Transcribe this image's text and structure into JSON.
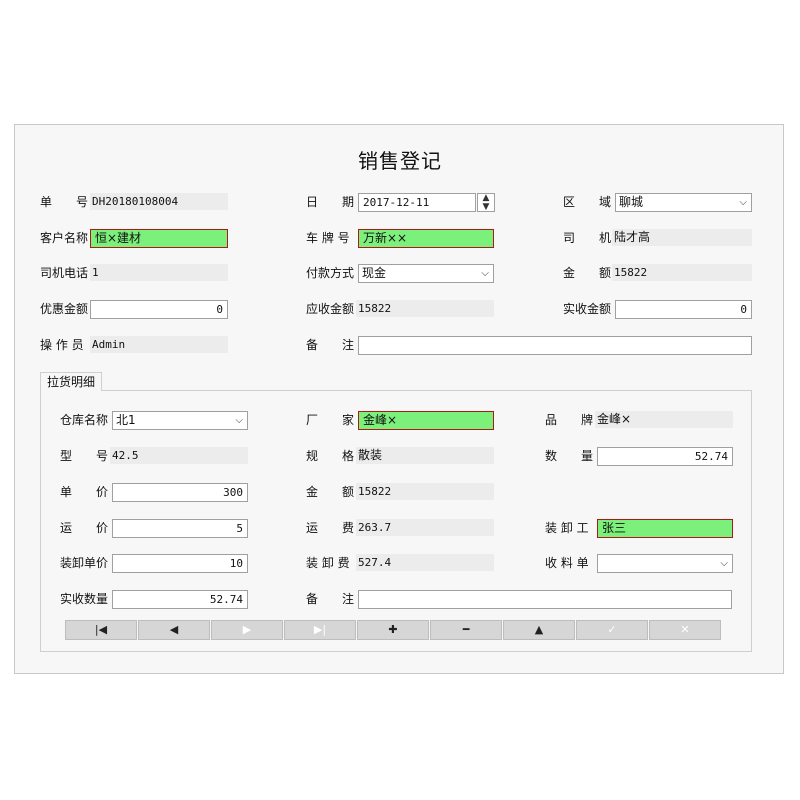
{
  "window": {
    "title": "销售登记"
  },
  "header": {
    "order_no_label": "单　　号",
    "order_no": "DH20180108004",
    "date_label": "日　　期",
    "date": "2017-12-11",
    "date_spin_icon": "spin-arrows",
    "region_label": "区　　域",
    "region": "聊城",
    "customer_label": "客户名称",
    "customer": "恒×建材",
    "plate_label": "车 牌 号",
    "plate": "万新××",
    "driver_label": "司　　机",
    "driver": "陆才高",
    "driver_phone_label": "司机电话",
    "driver_phone": "1",
    "pay_method_label": "付款方式",
    "pay_method": "现金",
    "amount_label": "金　　额",
    "amount": "15822",
    "discount_label": "优惠金额",
    "discount": "0",
    "receivable_label": "应收金额",
    "receivable": "15822",
    "received_label": "实收金额",
    "received": "0",
    "operator_label": "操 作 员",
    "operator": "Admin",
    "remark_label": "备　　注",
    "remark": ""
  },
  "detail": {
    "tab_label": "拉货明细",
    "warehouse_label": "仓库名称",
    "warehouse": "北1",
    "maker_label": "厂　　家",
    "maker": "金峰×",
    "brand_label": "品　　牌",
    "brand": "金峰×",
    "model_label": "型　　号",
    "model": "42.5",
    "spec_label": "规　　格",
    "spec": "散装",
    "qty_label": "数　　量",
    "qty": "52.74",
    "price_label": "单　　价",
    "price": "300",
    "amount_label": "金　　额",
    "amount": "15822",
    "freight_price_label": "运　　价",
    "freight_price": "5",
    "freight_label": "运　　费",
    "freight": "263.7",
    "loader_label": "装 卸 工",
    "loader": "张三",
    "load_price_label": "装卸单价",
    "load_price": "10",
    "load_fee_label": "装 卸 费",
    "load_fee": "527.4",
    "receipt_label": "收 料 单",
    "receipt": "",
    "actual_qty_label": "实收数量",
    "actual_qty": "52.74",
    "remark_label": "备　　注",
    "remark": ""
  },
  "navbar": {
    "buttons": [
      {
        "name": "first-icon",
        "glyph": "|◀",
        "enabled": true
      },
      {
        "name": "prev-icon",
        "glyph": "◀",
        "enabled": true
      },
      {
        "name": "next-icon",
        "glyph": "▶",
        "enabled": false
      },
      {
        "name": "last-icon",
        "glyph": "▶|",
        "enabled": false
      },
      {
        "name": "add-icon",
        "glyph": "✚",
        "enabled": true
      },
      {
        "name": "delete-icon",
        "glyph": "━",
        "enabled": true
      },
      {
        "name": "up-icon",
        "glyph": "▲",
        "enabled": true
      },
      {
        "name": "confirm-icon",
        "glyph": "✓",
        "enabled": false
      },
      {
        "name": "cancel-icon",
        "glyph": "✕",
        "enabled": false
      }
    ]
  }
}
